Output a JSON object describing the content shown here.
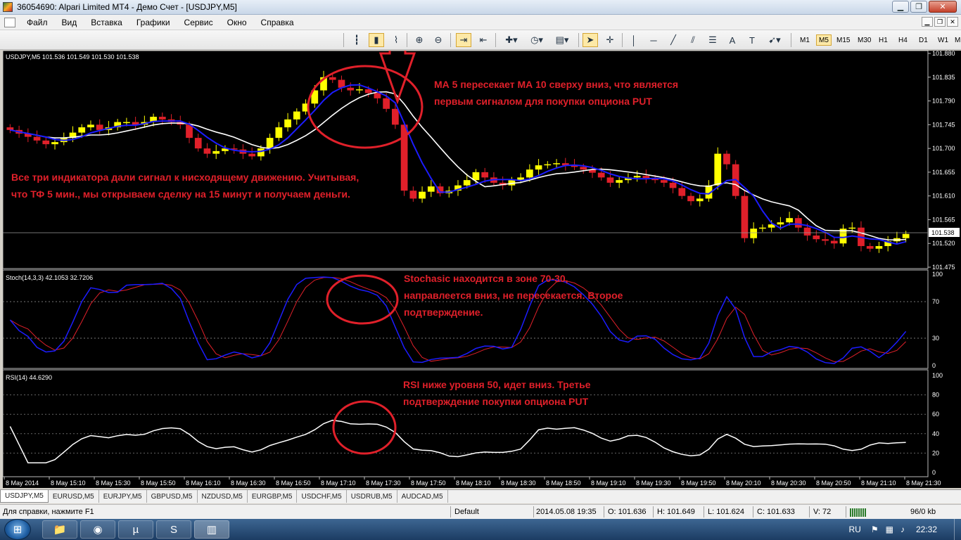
{
  "window": {
    "title": "36054690: Alpari Limited MT4 - Демо Счет - [USDJPY,M5]",
    "min_btn": "▁",
    "max_btn": "❐",
    "close_btn": "✕"
  },
  "menu": {
    "items": [
      "Файл",
      "Вид",
      "Вставка",
      "Графики",
      "Сервис",
      "Окно",
      "Справка"
    ]
  },
  "toolbar": {
    "icons": [
      "bar-chart-icon",
      "candlestick-icon",
      "line-chart-icon",
      "zoom-in-icon",
      "zoom-out-icon",
      "autoscroll-icon",
      "chart-shift-icon",
      "indicators-icon",
      "periods-icon",
      "templates-icon",
      "cursor-icon",
      "crosshair-icon",
      "vertical-line-icon",
      "horizontal-line-icon",
      "trendline-icon",
      "channel-icon",
      "fibonacci-icon",
      "text-icon",
      "text-label-icon",
      "arrows-icon"
    ],
    "text_tool": "A",
    "text_label_tool": "T",
    "timeframes": [
      "M1",
      "M5",
      "M15",
      "M30",
      "H1",
      "H4",
      "D1",
      "W1",
      "MN"
    ],
    "active_timeframe": "M5"
  },
  "chart": {
    "header": "USDJPY,M5  101.536 101.549 101.530 101.538",
    "current_price": "101.538",
    "price_ticks": [
      "101.880",
      "101.835",
      "101.790",
      "101.745",
      "101.700",
      "101.655",
      "101.610",
      "101.565",
      "101.520",
      "101.475"
    ],
    "stoch_header": "Stoch(14,3,3) 42.1053 32.7206",
    "stoch_ticks": [
      "100",
      "70",
      "30",
      "0"
    ],
    "rsi_header": "RSI(14) 44.6290",
    "rsi_ticks": [
      "100",
      "80",
      "60",
      "40",
      "20",
      "0"
    ],
    "time_ticks": [
      "8 May 2014",
      "8 May 15:10",
      "8 May 15:30",
      "8 May 15:50",
      "8 May 16:10",
      "8 May 16:30",
      "8 May 16:50",
      "8 May 17:10",
      "8 May 17:30",
      "8 May 17:50",
      "8 May 18:10",
      "8 May 18:30",
      "8 May 18:50",
      "8 May 19:10",
      "8 May 19:30",
      "8 May 19:50",
      "8 May 20:10",
      "8 May 20:30",
      "8 May 20:50",
      "8 May 21:10",
      "8 May 21:30"
    ],
    "colors": {
      "background": "#000000",
      "bull": "#ffff00",
      "bear": "#e0202a",
      "ma5": "#0000ff",
      "ma10": "#ffffff",
      "stoch_main": "#1c1cff",
      "stoch_signal": "#e0202a",
      "rsi": "#ffffff",
      "annotation": "#e0202a"
    }
  },
  "annotations": {
    "ma": "МА 5 пересекает МА 10 сверху вниз, что является первым сигналом для покупки опциона PUT",
    "summary": "Все три индикатора дали сигнал к нисходящему движению. Учитывая, что ТФ 5 мин., мы открываем сделку на 15 минут и получаем деньги.",
    "stoch": "Stochasic находится в зоне 70-30, направлеется вниз, не пересекается. Второе подтверждение.",
    "rsi": "RSI ниже уровня 50, идет вниз. Третье подтверждение покупки опциона PUT"
  },
  "tabs": [
    "USDJPY,M5",
    "EURUSD,M5",
    "EURJPY,M5",
    "GBPUSD,M5",
    "NZDUSD,M5",
    "EURGBP,M5",
    "USDCHF,M5",
    "USDRUB,M5",
    "AUDCAD,M5"
  ],
  "active_tab": "USDJPY,M5",
  "statusbar": {
    "help": "Для справки, нажмите F1",
    "profile": "Default",
    "datetime": "2014.05.08 19:35",
    "open": "O: 101.636",
    "high": "H: 101.649",
    "low": "L: 101.624",
    "close": "C: 101.633",
    "volume": "V: 72",
    "traffic": "96/0 kb"
  },
  "taskbar": {
    "start_icon": "⊞",
    "apps": [
      "explorer-icon",
      "firefox-icon",
      "utorrent-icon",
      "skype-icon",
      "metatrader-icon"
    ],
    "language": "RU",
    "clock": "22:32"
  }
}
